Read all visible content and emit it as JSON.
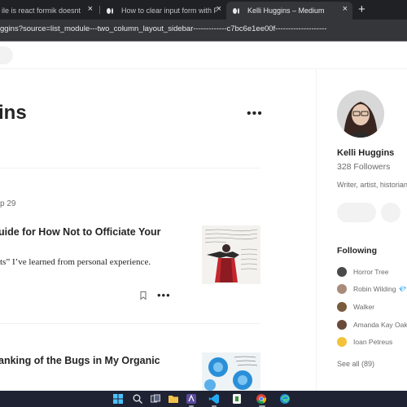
{
  "browser": {
    "tabs": [
      {
        "title": "ile is react formik doesnt clear",
        "active": false
      },
      {
        "title": "How to clear input form with Fo",
        "active": false
      },
      {
        "title": "Kelli Huggins – Medium",
        "active": true
      }
    ],
    "close_glyph": "×",
    "new_tab_glyph": "+",
    "url": "ggins?source=list_module---two_column_layout_sidebar-------------c7bc6e1ee00f--------------------"
  },
  "main": {
    "profile_name": "ins",
    "more_glyph": "•••",
    "articles": [
      {
        "date": "p 29",
        "title": "uide for How Not to Officiate Your",
        "subtitle": "ts” I’ve learned from personal experience."
      },
      {
        "title": "anking of the Bugs in My Organic"
      }
    ]
  },
  "sidebar": {
    "name": "Kelli Huggins",
    "followers": "328 Followers",
    "bio": "Writer, artist, historian",
    "following_heading": "Following",
    "following": [
      {
        "name": "Horror Tree",
        "color": "#4a4a4a",
        "badge": ""
      },
      {
        "name": "Robin Wilding",
        "color": "#a98b7a",
        "badge": "💎"
      },
      {
        "name": "Walker",
        "color": "#7a5a3c",
        "badge": ""
      },
      {
        "name": "Amanda Kay Oak",
        "color": "#6b4a3a",
        "badge": ""
      },
      {
        "name": "Ioan Petreus",
        "color": "#f2c23a",
        "badge": ""
      }
    ],
    "see_all": "See all (89)"
  },
  "colors": {
    "tab_strip": "#202124",
    "address_bar": "#35363a",
    "text_primary": "#242424",
    "text_secondary": "#6b6b6b",
    "taskbar": "#1e2233"
  },
  "taskbar": {
    "icons": [
      "windows-start-icon",
      "search-icon",
      "task-view-icon",
      "file-explorer-icon",
      "app-icon",
      "vscode-icon",
      "app-icon-2",
      "chrome-icon",
      "edge-icon"
    ]
  }
}
